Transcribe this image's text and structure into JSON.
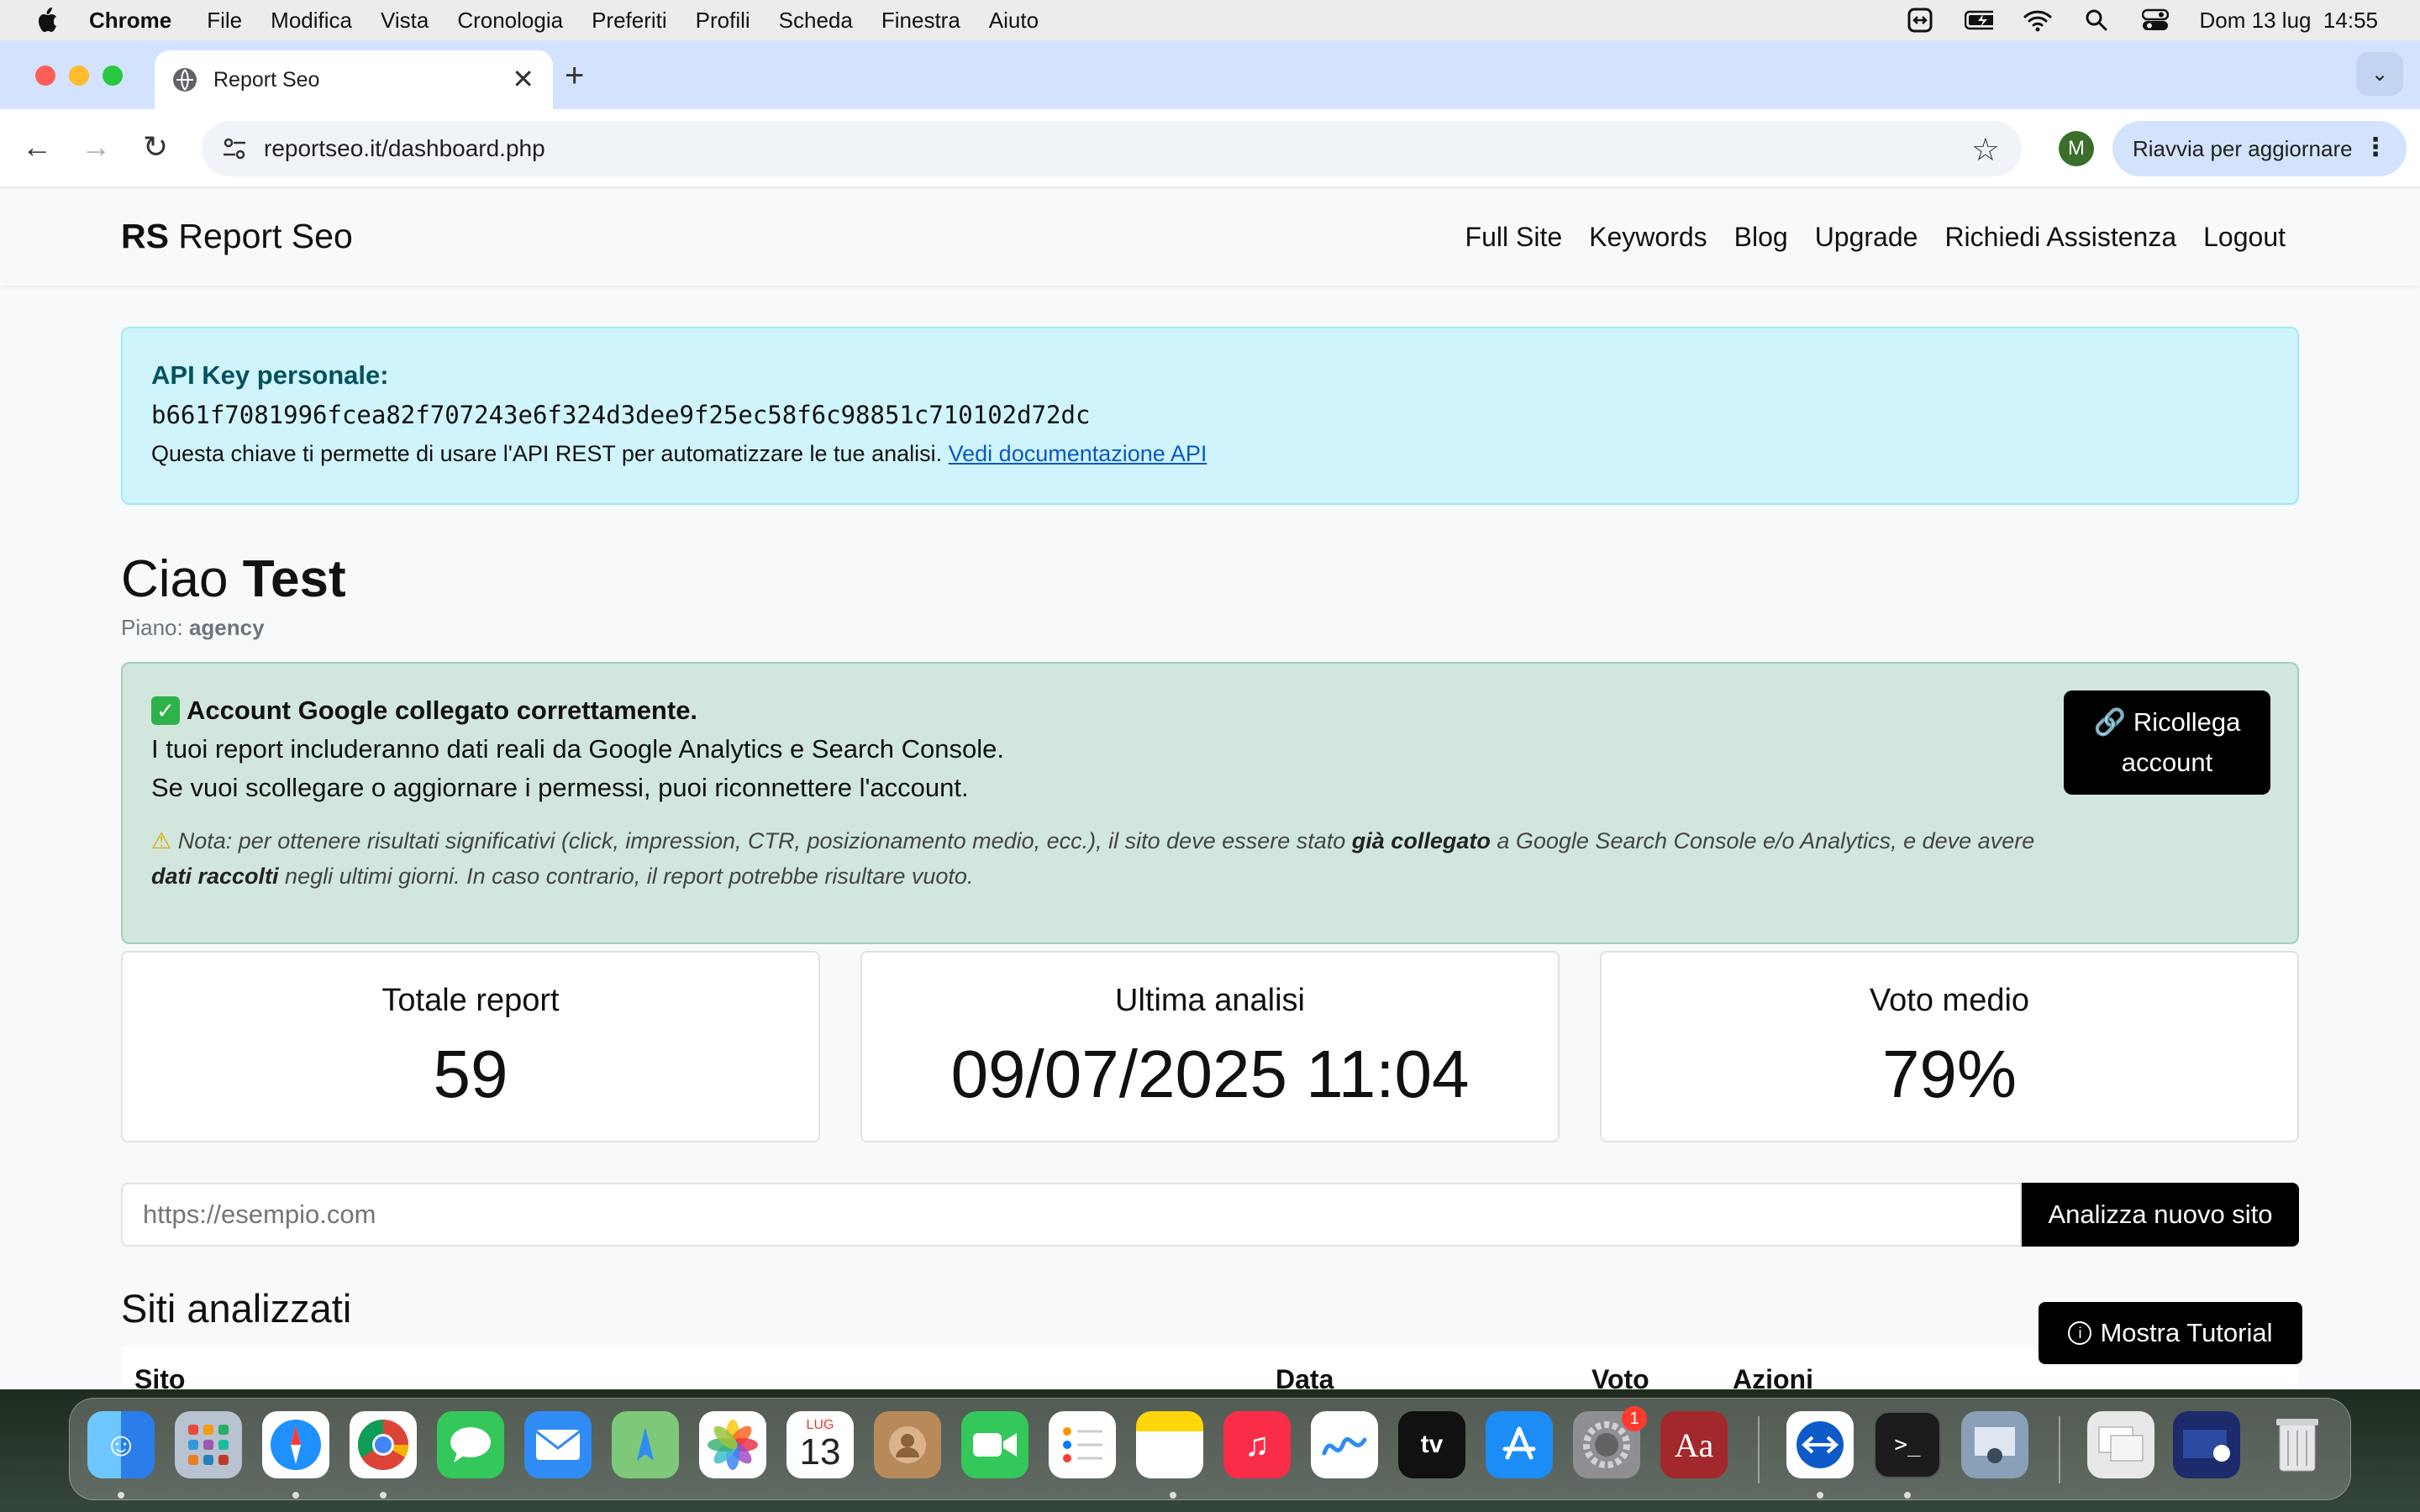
{
  "menubar": {
    "items": [
      "Chrome",
      "File",
      "Modifica",
      "Vista",
      "Cronologia",
      "Preferiti",
      "Profili",
      "Scheda",
      "Finestra",
      "Aiuto"
    ],
    "datetime": "Dom 13 lug  14:55"
  },
  "browser": {
    "tab_title": "Report Seo",
    "url": "reportseo.it/dashboard.php",
    "profile_initial": "M",
    "relaunch_label": "Riavvia per aggiornare"
  },
  "site": {
    "brand_bold": "RS",
    "brand_rest": " Report Seo",
    "nav": [
      "Full Site",
      "Keywords",
      "Blog",
      "Upgrade",
      "Richiedi Assistenza",
      "Logout"
    ]
  },
  "api": {
    "title": "API Key personale:",
    "key": "b661f7081996fcea82f707243e6f324d3dee9f25ec58f6c98851c710102d72dc",
    "desc": "Questa chiave ti permette di usare l'API REST per automatizzare le tue analisi. ",
    "doc_link": "Vedi documentazione API"
  },
  "user": {
    "greeting": "Ciao ",
    "name": "Test",
    "plan_label": "Piano: ",
    "plan": "agency"
  },
  "google": {
    "title": "Account Google collegato correttamente.",
    "line1": "I tuoi report includeranno dati reali da Google Analytics e Search Console.",
    "line2": "Se vuoi scollegare o aggiornare i permessi, puoi riconnettere l'account.",
    "note_a": "Nota: per ottenere risultati significativi (click, impression, CTR, posizionamento medio, ecc.), il sito deve essere stato ",
    "note_b": "già collegato",
    "note_c": " a Google Search Console e/o Analytics, e deve avere ",
    "note_d": "dati raccolti",
    "note_e": " negli ultimi giorni. In caso contrario, il report potrebbe risultare vuoto.",
    "relink_line1": "Ricollega",
    "relink_line2": "account"
  },
  "stats": [
    {
      "label": "Totale report",
      "value": "59"
    },
    {
      "label": "Ultima analisi",
      "value": "09/07/2025 11:04"
    },
    {
      "label": "Voto medio",
      "value": "79%"
    }
  ],
  "analyze": {
    "placeholder": "https://esempio.com",
    "button": "Analizza nuovo sito"
  },
  "sites": {
    "title": "Siti analizzati",
    "columns": [
      "Sito",
      "Data",
      "Voto",
      "Azioni"
    ]
  },
  "tutorial_label": "Mostra Tutorial",
  "dock": {
    "calendar_month": "LUG",
    "calendar_day": "13",
    "settings_badge": "1"
  }
}
